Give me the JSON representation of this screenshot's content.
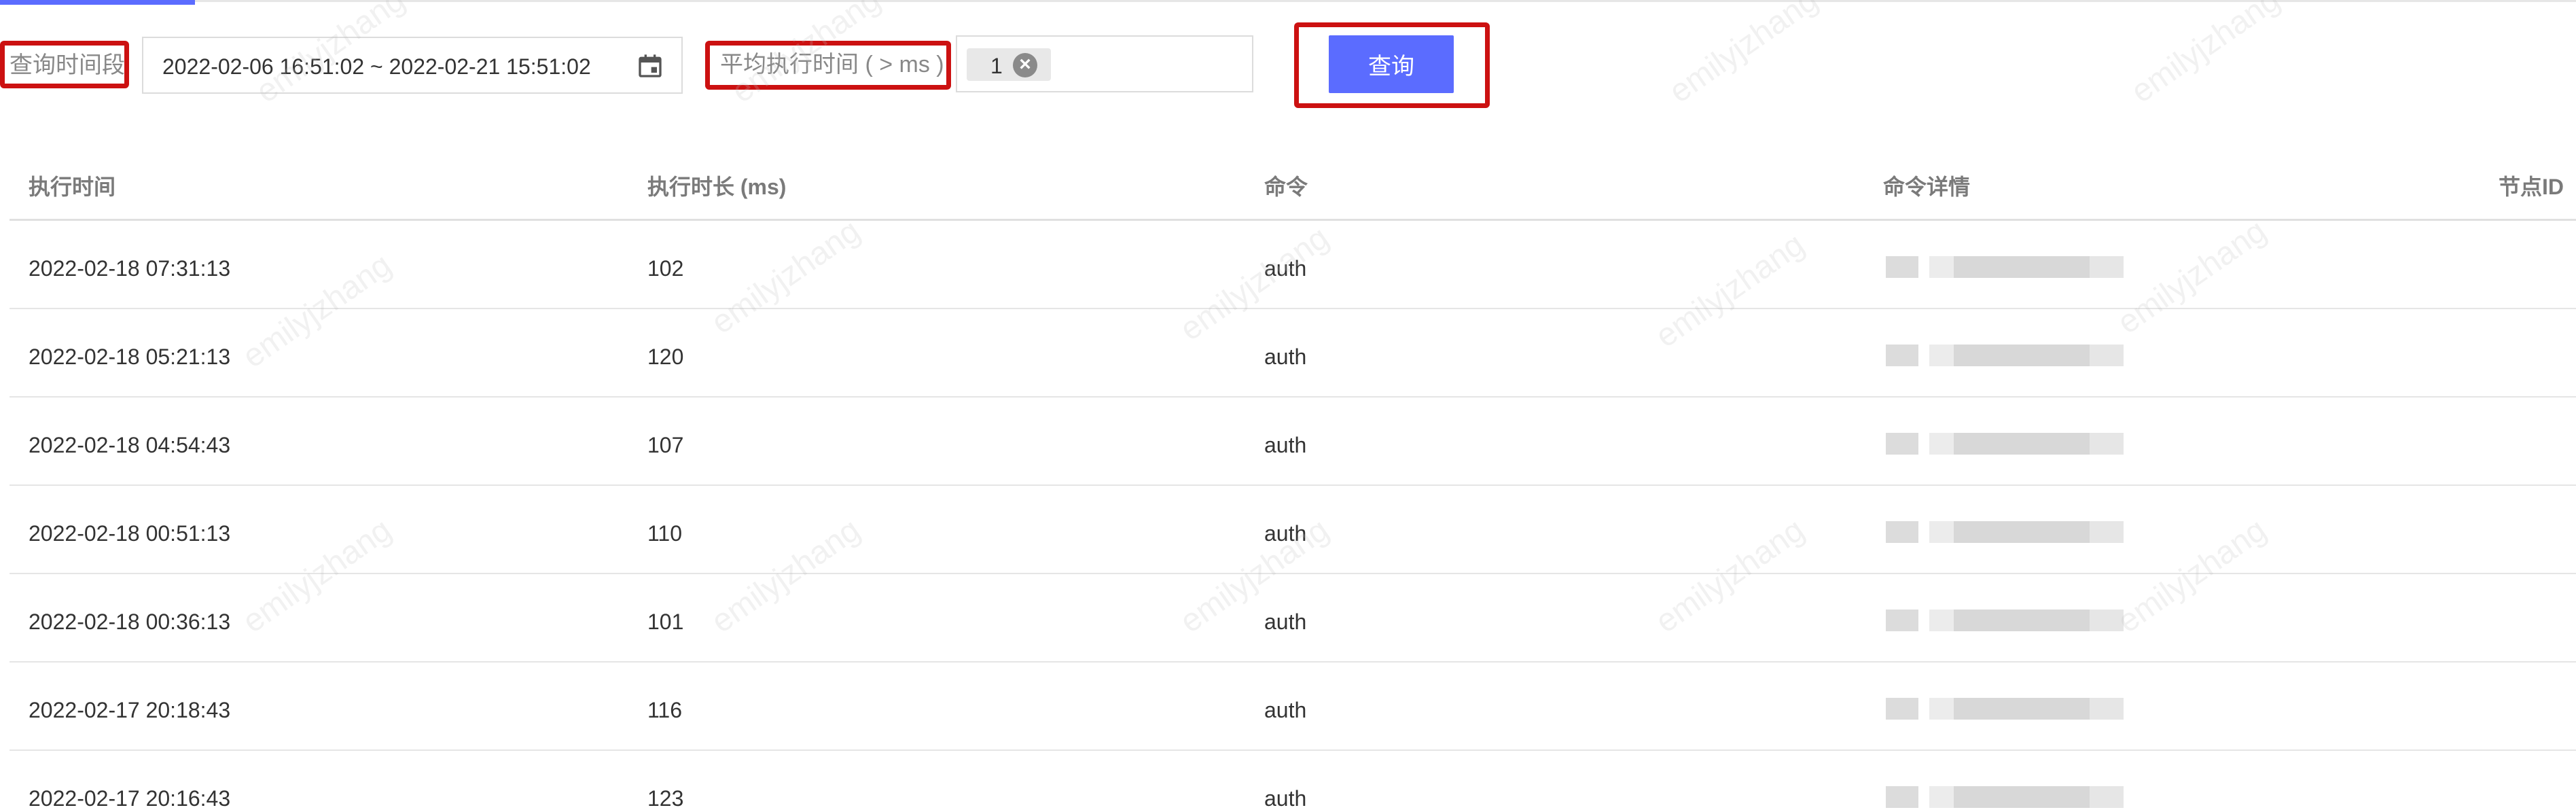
{
  "filters": {
    "time_label": "查询时间段",
    "date_range": "2022-02-06 16:51:02 ~ 2022-02-21 15:51:02",
    "avg_label": "平均执行时间 ( > ms )",
    "avg_tag_value": "1",
    "tag_remove_glyph": "×",
    "query_label": "查询"
  },
  "table": {
    "columns": [
      "执行时间",
      "执行时长 (ms)",
      "命令",
      "命令详情",
      "节点ID"
    ],
    "rows": [
      {
        "time": "2022-02-18 07:31:13",
        "duration": "102",
        "command": "auth"
      },
      {
        "time": "2022-02-18 05:21:13",
        "duration": "120",
        "command": "auth"
      },
      {
        "time": "2022-02-18 04:54:43",
        "duration": "107",
        "command": "auth"
      },
      {
        "time": "2022-02-18 00:51:13",
        "duration": "110",
        "command": "auth"
      },
      {
        "time": "2022-02-18 00:36:13",
        "duration": "101",
        "command": "auth"
      },
      {
        "time": "2022-02-17 20:18:43",
        "duration": "116",
        "command": "auth"
      },
      {
        "time": "2022-02-17 20:16:43",
        "duration": "123",
        "command": "auth"
      }
    ]
  },
  "watermark": "emilyjzhang",
  "colors": {
    "accent": "#5b6cff",
    "highlight": "#cc1111"
  },
  "icons": {
    "calendar": "calendar-icon",
    "tag_close": "close-circle-icon"
  }
}
